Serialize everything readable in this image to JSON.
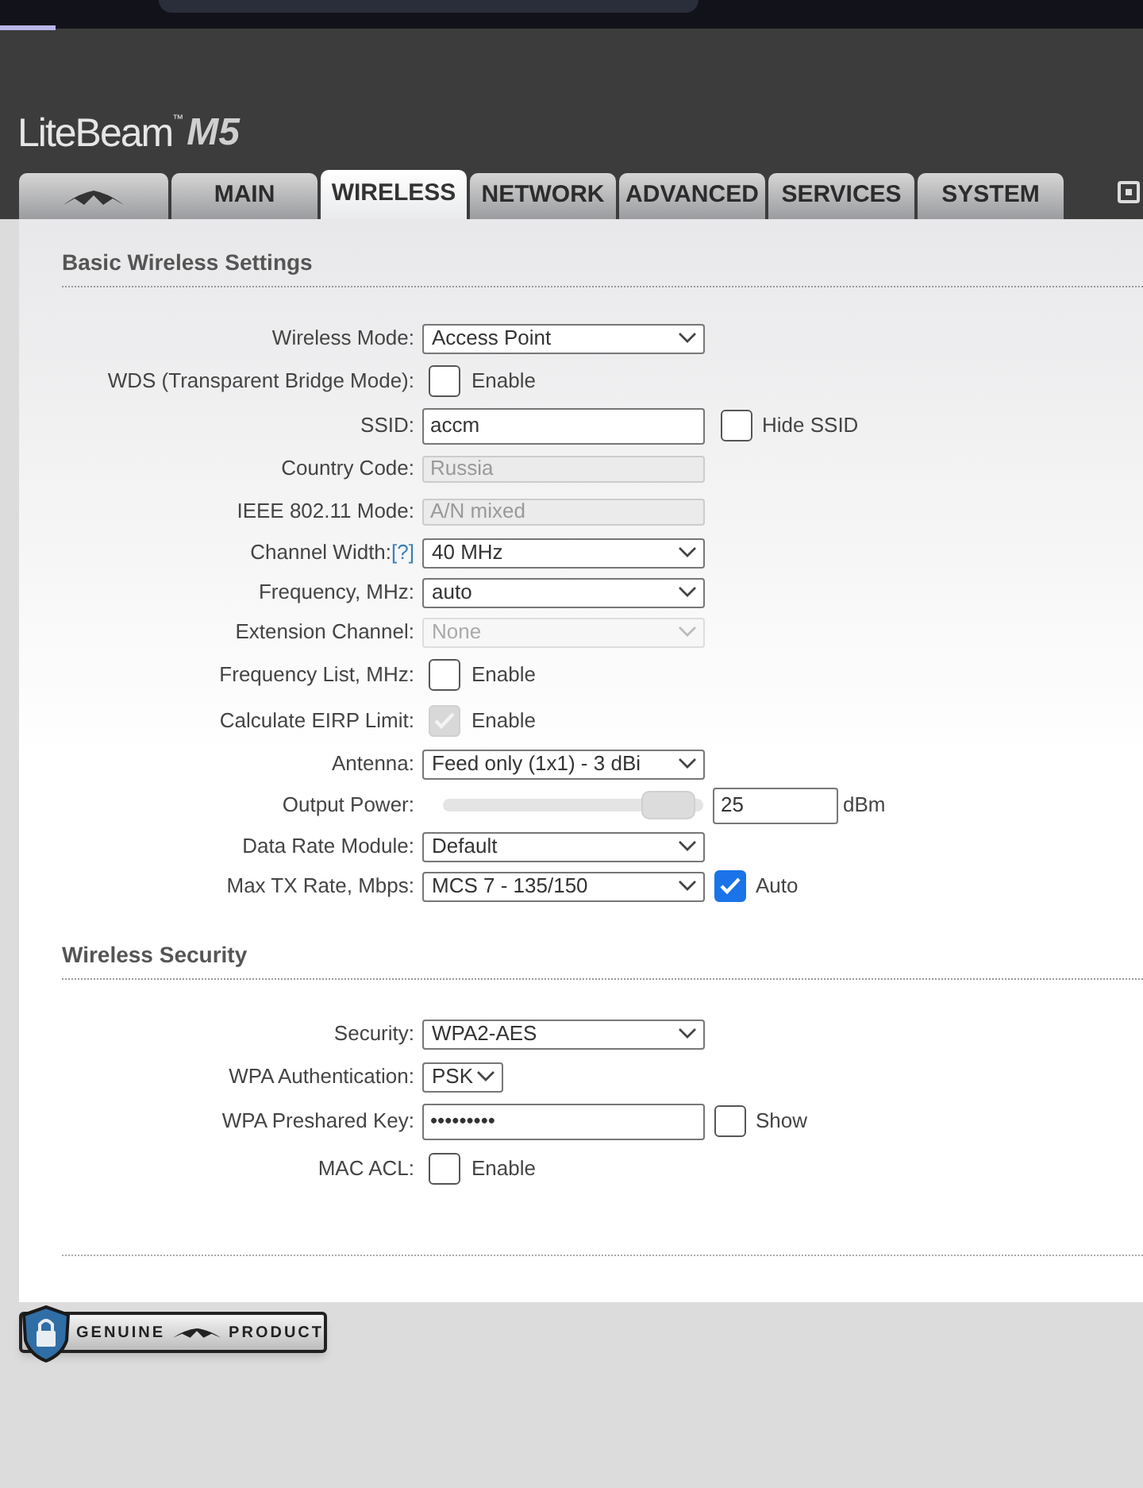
{
  "logo": {
    "brand": "LiteBeam",
    "trademark": "™",
    "model": "M5"
  },
  "tabs": [
    {
      "kind": "icon",
      "selected": false
    },
    {
      "kind": "text",
      "label": "MAIN",
      "selected": false
    },
    {
      "kind": "text",
      "label": "WIRELESS",
      "selected": true
    },
    {
      "kind": "text",
      "label": "NETWORK",
      "selected": false
    },
    {
      "kind": "text",
      "label": "ADVANCED",
      "selected": false
    },
    {
      "kind": "text",
      "label": "SERVICES",
      "selected": false
    },
    {
      "kind": "text",
      "label": "SYSTEM",
      "selected": false
    }
  ],
  "sections": [
    {
      "title": "Basic Wireless Settings",
      "fields": [
        {
          "label": "Wireless Mode:",
          "kind": "select",
          "value": "Access Point",
          "disabled": false
        },
        {
          "label": "WDS (Transparent Bridge Mode):",
          "kind": "checkbox",
          "option": "Enable",
          "checked": false
        },
        {
          "label": "SSID:",
          "kind": "text",
          "value": "accm",
          "disabled": false,
          "extra": {
            "label": "Hide SSID",
            "checked": false
          }
        },
        {
          "label": "Country Code:",
          "kind": "text",
          "value": "Russia",
          "disabled": true
        },
        {
          "label": "IEEE 802.11 Mode:",
          "kind": "text",
          "value": "A/N mixed",
          "disabled": true
        },
        {
          "label": "Channel Width:",
          "help": "[?]",
          "kind": "select",
          "value": "40 MHz",
          "disabled": false
        },
        {
          "label": "Frequency, MHz:",
          "kind": "select",
          "value": "auto",
          "disabled": false
        },
        {
          "label": "Extension Channel:",
          "kind": "select",
          "value": "None",
          "disabled": true
        },
        {
          "label": "Frequency List, MHz:",
          "kind": "checkbox",
          "option": "Enable",
          "checked": false
        },
        {
          "label": "Calculate EIRP Limit:",
          "kind": "checkbox",
          "option": "Enable",
          "checked": true,
          "disabled": true
        },
        {
          "label": "Antenna:",
          "kind": "select",
          "value": "Feed only (1x1) - 3 dBi",
          "disabled": false
        },
        {
          "label": "Output Power:",
          "kind": "slider",
          "level": 0.97,
          "value": "25",
          "unit": "dBm"
        },
        {
          "label": "Data Rate Module:",
          "kind": "select",
          "value": "Default",
          "disabled": false
        },
        {
          "label": "Max TX Rate, Mbps:",
          "kind": "select",
          "value": "MCS 7 - 135/150",
          "disabled": false,
          "extra": {
            "label": "Auto",
            "checked": true
          }
        }
      ]
    },
    {
      "title": "Wireless Security",
      "fields": [
        {
          "label": "Security:",
          "kind": "select",
          "value": "WPA2-AES",
          "disabled": false
        },
        {
          "label": "WPA Authentication:",
          "kind": "small_select",
          "value": "PSK",
          "disabled": false
        },
        {
          "label": "WPA Preshared Key:",
          "kind": "text",
          "value": "•••••••••",
          "disabled": false,
          "extra": {
            "label": "Show",
            "checked": false
          }
        },
        {
          "label": "MAC ACL:",
          "kind": "checkbox",
          "option": "Enable",
          "checked": false
        }
      ]
    }
  ],
  "badge": {
    "left": "GENUINE",
    "right": "PRODUCT"
  }
}
